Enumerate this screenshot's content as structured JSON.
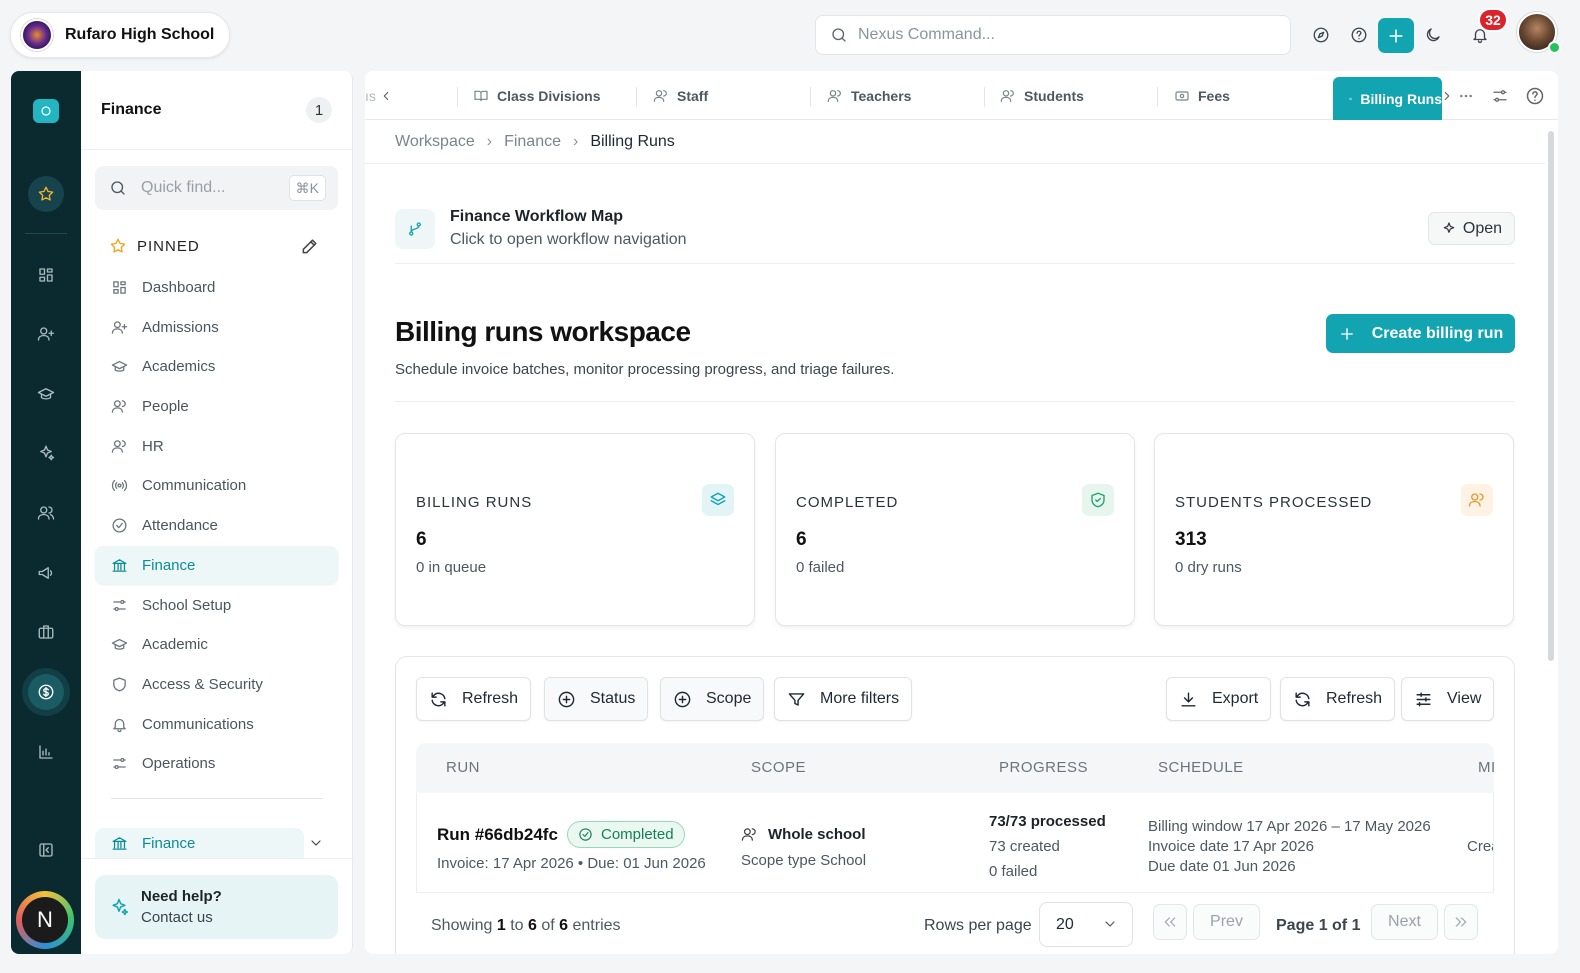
{
  "topbar": {
    "school_name": "Rufaro High School",
    "command_placeholder": "Nexus Command...",
    "notifications_count": "32"
  },
  "rail": {
    "user_initial": "N"
  },
  "sidebar": {
    "title": "Finance",
    "count": "1",
    "quick_find_placeholder": "Quick find...",
    "quick_find_shortcut": "⌘K",
    "pinned_label": "PINNED",
    "items": [
      {
        "label": "Dashboard",
        "icon": "grid-icon"
      },
      {
        "label": "Admissions",
        "icon": "user-plus-icon"
      },
      {
        "label": "Academics",
        "icon": "graduation-cap-icon"
      },
      {
        "label": "People",
        "icon": "users-icon"
      },
      {
        "label": "HR",
        "icon": "users-icon"
      },
      {
        "label": "Communication",
        "icon": "broadcast-icon"
      },
      {
        "label": "Attendance",
        "icon": "check-circle-icon"
      },
      {
        "label": "Finance",
        "icon": "bank-icon"
      },
      {
        "label": "School Setup",
        "icon": "sliders-icon"
      },
      {
        "label": "Academic",
        "icon": "graduation-cap-icon"
      },
      {
        "label": "Access & Security",
        "icon": "shield-icon"
      },
      {
        "label": "Communications",
        "icon": "bell-icon"
      },
      {
        "label": "Operations",
        "icon": "sliders-icon"
      }
    ],
    "section_label": "Finance",
    "help_title": "Need help?",
    "help_sub": "Contact us"
  },
  "tabs": {
    "partial": "ıs",
    "items": [
      {
        "label": "Class Divisions"
      },
      {
        "label": "Staff"
      },
      {
        "label": "Teachers"
      },
      {
        "label": "Students"
      },
      {
        "label": "Fees"
      }
    ],
    "active": "Billing Runs"
  },
  "breadcrumb": [
    "Workspace",
    "Finance",
    "Billing Runs"
  ],
  "workflow": {
    "title": "Finance Workflow Map",
    "subtitle": "Click to open workflow navigation",
    "open_label": "Open"
  },
  "page": {
    "title": "Billing runs workspace",
    "subtitle": "Schedule invoice batches, monitor processing progress, and triage failures.",
    "create_label": "Create billing run"
  },
  "stats": [
    {
      "label": "BILLING RUNS",
      "value": "6",
      "sub": "0 in queue",
      "color": "#13a4b2"
    },
    {
      "label": "COMPLETED",
      "value": "6",
      "sub": "0 failed",
      "color": "#1fa36b"
    },
    {
      "label": "STUDENTS PROCESSED",
      "value": "313",
      "sub": "0 dry runs",
      "color": "#e39a2c"
    }
  ],
  "toolbar": {
    "refresh": "Refresh",
    "status": "Status",
    "scope": "Scope",
    "more_filters": "More filters",
    "export": "Export",
    "refresh2": "Refresh",
    "view": "View"
  },
  "table": {
    "columns": [
      "RUN",
      "SCOPE",
      "PROGRESS",
      "SCHEDULE",
      "MI"
    ],
    "row": {
      "run": "Run #66db24fc",
      "status": "Completed",
      "invoice": "Invoice: 17 Apr 2026 • Due: 01 Jun 2026",
      "scope": "Whole school",
      "scope_type": "Scope type School",
      "progress": "73/73 processed",
      "created": "73 created",
      "failed": "0 failed",
      "billing_window": "Billing window 17 Apr 2026 – 17 May 2026",
      "invoice_date": "Invoice date 17 Apr 2026",
      "due_date": "Due date 01 Jun 2026",
      "extra": "Crea"
    }
  },
  "pagination": {
    "showing_prefix": "Showing",
    "from": "1",
    "to_word": "to",
    "to": "6",
    "of_word": "of",
    "total": "6",
    "entries_word": "entries",
    "rows_per_page_label": "Rows per page",
    "rows_per_page": "20",
    "prev": "Prev",
    "next": "Next",
    "page_info": "Page 1 of 1"
  }
}
